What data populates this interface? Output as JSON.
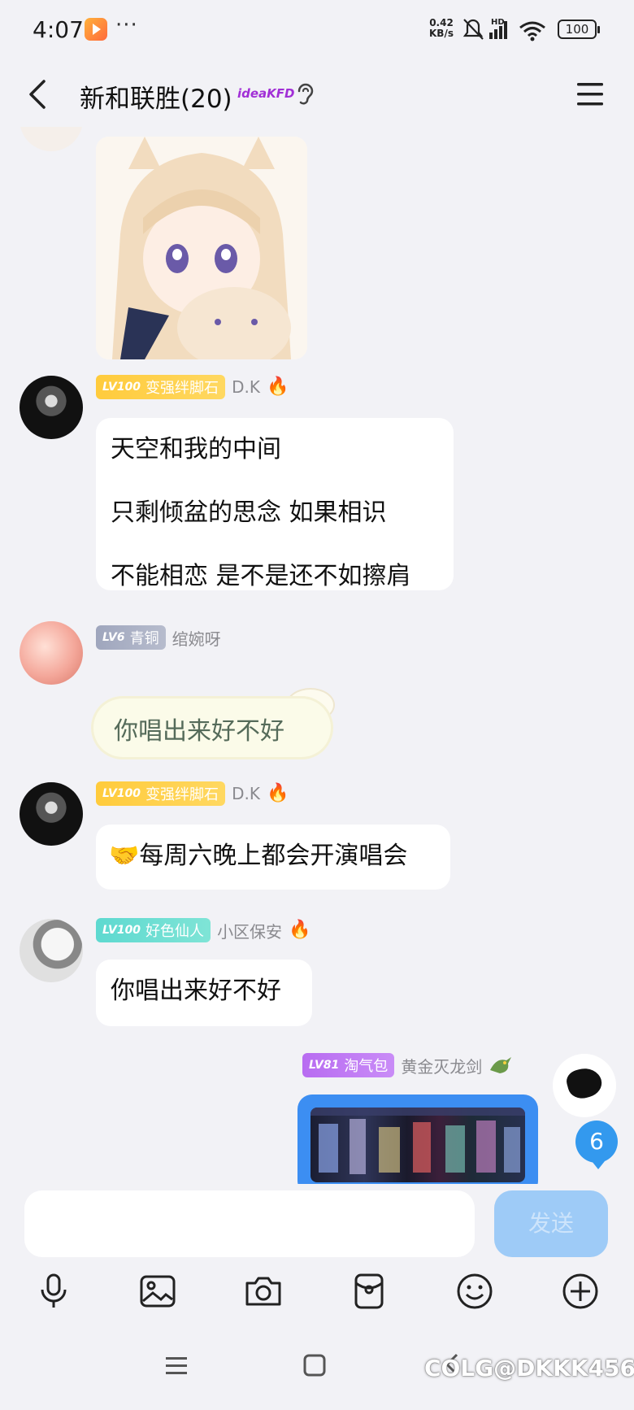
{
  "status_bar": {
    "time": "4:07",
    "dots": "···",
    "net_speed_value": "0.42",
    "net_speed_unit": "KB/s",
    "network_type": "HD",
    "battery": "100"
  },
  "header": {
    "title": "新和联胜(20)",
    "title_badge": "ideaKFD"
  },
  "messages": [
    {
      "type": "sticker",
      "description_icon": "anime-girl-cat-sticker"
    },
    {
      "level": "LV100",
      "title": "变强绊脚石",
      "nickname": "D.K",
      "flame": "🔥",
      "lines": [
        "天空和我的中间",
        "只剩倾盆的思念 如果相识",
        "不能相恋 是不是还不如擦肩"
      ]
    },
    {
      "level": "LV6",
      "title": "青铜",
      "nickname": "绾婉呀",
      "text": "你唱出来好不好"
    },
    {
      "level": "LV100",
      "title": "变强绊脚石",
      "nickname": "D.K",
      "flame": "🔥",
      "emoji": "🤝",
      "text": "每周六晚上都会开演唱会"
    },
    {
      "level": "LV100",
      "title": "好色仙人",
      "nickname": "小区保安",
      "flame": "🔥",
      "text": "你唱出来好不好"
    },
    {
      "self": true,
      "level": "LV81",
      "title": "淘气包",
      "nickname": "黄金灭龙剑",
      "badge_icon": "dragon-badge-icon",
      "type": "image-card"
    }
  ],
  "unread_count": "6",
  "input": {
    "send_label": "发送",
    "placeholder": ""
  },
  "watermark": "COLG@DKKK456",
  "colors": {
    "accent": "#3399ee",
    "send_disabled": "#9ecbf7",
    "background": "#f2f2f6"
  }
}
